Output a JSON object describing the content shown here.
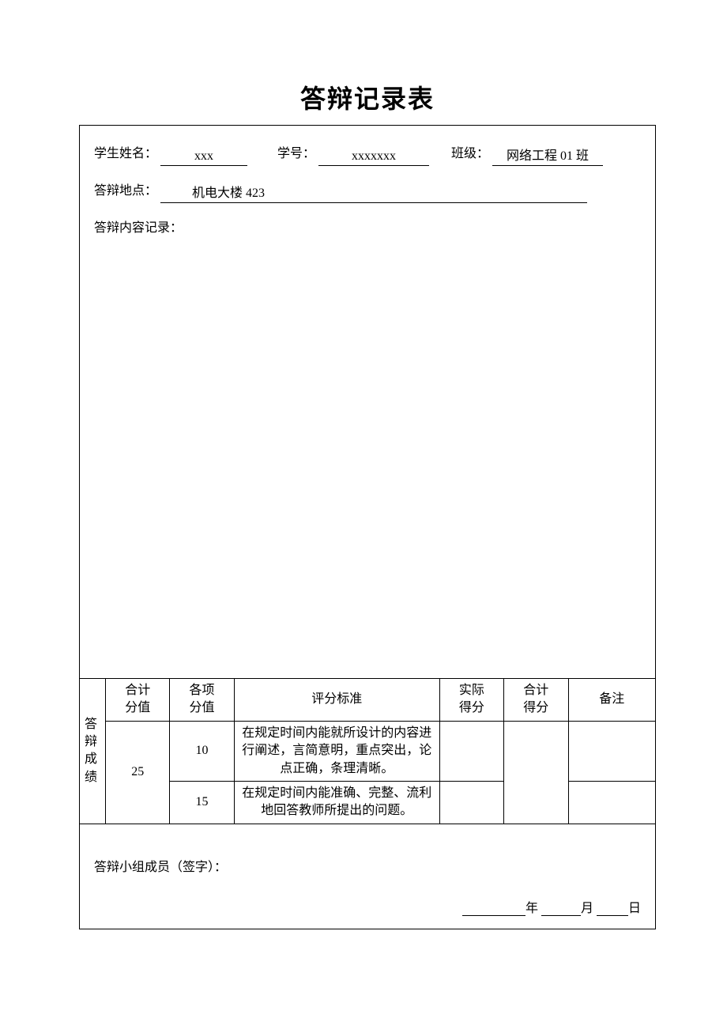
{
  "title": "答辩记录表",
  "fields": {
    "name_label": "学生姓名：",
    "name_value": "xxx",
    "id_label": "学号：",
    "id_value": "xxxxxxx",
    "class_label": "班级：",
    "class_value": "网络工程 01 班",
    "location_label": "答辩地点：",
    "location_value": "机电大楼 423",
    "record_label": "答辩内容记录："
  },
  "score_table": {
    "row_header": "答辩成绩",
    "headers": {
      "total_points": "合计分值",
      "item_points": "各项分值",
      "criteria": "评分标准",
      "actual_score": "实际得分",
      "total_score": "合计得分",
      "remark": "备注"
    },
    "total_points_value": "25",
    "rows": [
      {
        "item_points": "10",
        "criteria": "在规定时间内能就所设计的内容进行阐述，言简意明，重点突出，论点正确，条理清晰。",
        "actual_score": "",
        "remark": ""
      },
      {
        "item_points": "15",
        "criteria": "在规定时间内能准确、完整、流利地回答教师所提出的问题。",
        "actual_score": "",
        "remark": ""
      }
    ],
    "total_score_value": ""
  },
  "signature": {
    "label": "答辩小组成员（签字）：",
    "year": "年",
    "month": "月",
    "day": "日"
  }
}
